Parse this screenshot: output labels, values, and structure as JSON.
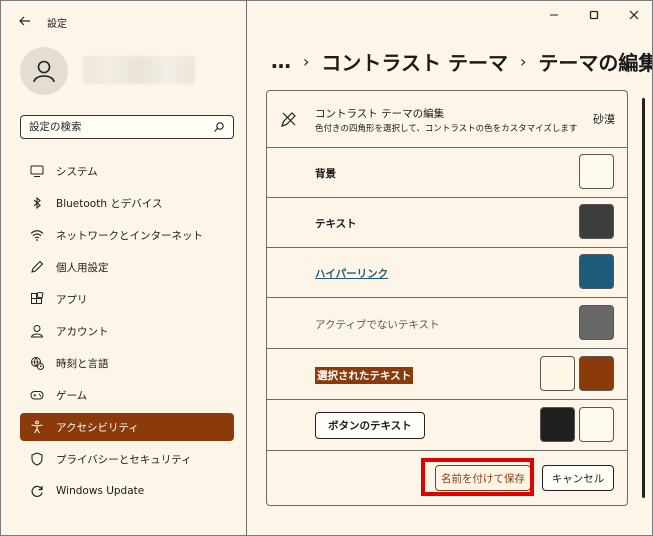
{
  "app": {
    "title": "設定"
  },
  "search": {
    "placeholder": "設定の検索"
  },
  "sidebar": {
    "items": [
      {
        "label": "システム",
        "icon": "monitor-icon"
      },
      {
        "label": "Bluetooth とデバイス",
        "icon": "bluetooth-icon"
      },
      {
        "label": "ネットワークとインターネット",
        "icon": "wifi-icon"
      },
      {
        "label": "個人用設定",
        "icon": "pen-icon"
      },
      {
        "label": "アプリ",
        "icon": "apps-icon"
      },
      {
        "label": "アカウント",
        "icon": "person-icon"
      },
      {
        "label": "時刻と言語",
        "icon": "globe-clock-icon"
      },
      {
        "label": "ゲーム",
        "icon": "gamepad-icon"
      },
      {
        "label": "アクセシビリティ",
        "icon": "accessibility-icon",
        "active": true
      },
      {
        "label": "プライバシーとセキュリティ",
        "icon": "shield-icon"
      },
      {
        "label": "Windows Update",
        "icon": "update-icon"
      }
    ]
  },
  "breadcrumb": {
    "ellipsis": "…",
    "parent": "コントラスト テーマ",
    "current": "テーマの編集"
  },
  "editor": {
    "title": "コントラスト テーマの編集",
    "subtitle": "色付きの四角形を選択して、コントラストの色をカスタマイズします",
    "theme_name": "砂漠",
    "rows": [
      {
        "label": "背景",
        "colors": [
          "#fffaf0"
        ]
      },
      {
        "label": "テキスト",
        "colors": [
          "#3d3d3d"
        ]
      },
      {
        "label": "ハイパーリンク",
        "colors": [
          "#1c5b7a"
        ]
      },
      {
        "label": "アクティブでないテキスト",
        "colors": [
          "#676767"
        ]
      },
      {
        "label": "選択されたテキスト",
        "colors": [
          "#fff6e5",
          "#8a3a0b"
        ]
      },
      {
        "label": "ボタンのテキスト",
        "colors": [
          "#202020",
          "#fffaf0"
        ]
      }
    ],
    "save_label": "名前を付けて保存",
    "cancel_label": "キャンセル"
  },
  "colors": {
    "accent": "#8a3a0b",
    "highlight": "#e00000",
    "background": "#fdf6e8"
  }
}
